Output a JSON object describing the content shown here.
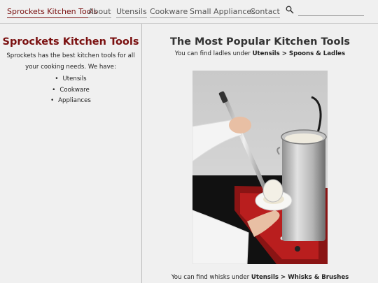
{
  "nav": {
    "brand": "Sprockets Kitchen Tools",
    "items": [
      "About",
      "Utensils",
      "Cookware",
      "Small Appliances",
      "Contact"
    ],
    "search_icon": "search-icon"
  },
  "sidebar": {
    "title": "Sprockets Kitchen Tools",
    "intro": "Sprockets has the best kitchen tools for all your cooking needs. We have:",
    "items": [
      "Utensils",
      "Cookware",
      "Appliances"
    ]
  },
  "main": {
    "title": "The Most Popular Kitchen Tools",
    "caption1_prefix": "You can find ladles under ",
    "caption1_path": "Utensils > Spoons & Ladles",
    "caption2_prefix": "You can find whisks under ",
    "caption2_path": "Utensils > Whisks & Brushes"
  },
  "colors": {
    "brand": "#7a1010",
    "background": "#f0f0f0"
  }
}
